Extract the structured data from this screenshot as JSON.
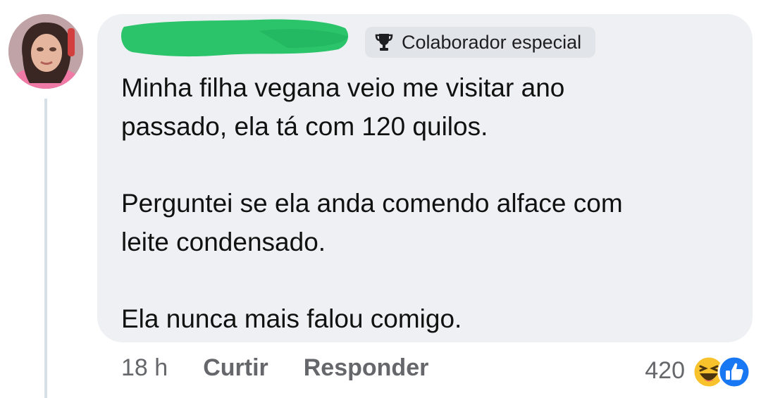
{
  "comment": {
    "badge_label": "Colaborador especial",
    "paragraphs": [
      "Minha filha vegana veio me visitar ano\npassado, ela tá com 120 quilos.",
      "Perguntei se ela anda comendo alface com\nleite condensado.",
      "Ela nunca mais falou comigo."
    ],
    "time": "18 h",
    "like_label": "Curtir",
    "reply_label": "Responder",
    "reaction_count": "420",
    "reactions": [
      "haha-icon",
      "like-icon"
    ]
  },
  "colors": {
    "bubble": "#eef0f3",
    "redaction": "#2cc46b",
    "like_blue": "#1877f2",
    "haha_yellow": "#f7c22b",
    "meta_gray": "#65676b"
  }
}
